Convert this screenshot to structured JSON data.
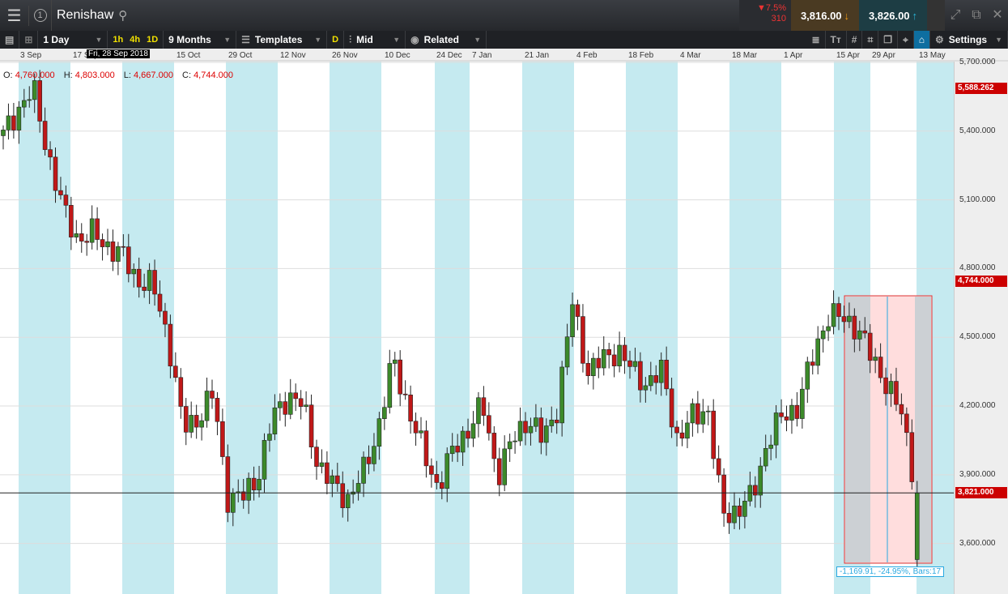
{
  "header": {
    "menu_icon": "hamburger-icon",
    "window_number": "1",
    "title": "Renishaw",
    "search_icon": "search-icon",
    "change_pct": "▼7.5%",
    "change_pts": "310",
    "sell": "3,816.00",
    "buy": "3,826.00",
    "sell_color": "#f39c12",
    "buy_color": "#29b6d8"
  },
  "toolbar": {
    "interval": "1 Day",
    "quick": [
      "1h",
      "4h",
      "1D"
    ],
    "range": "9 Months",
    "templates": "Templates",
    "d": "D",
    "price_type": "Mid",
    "related": "Related",
    "settings": "Settings"
  },
  "tooltip_date": "Fri, 28 Sep 2018",
  "ohlc": {
    "o_label": "O:",
    "o": "4,760.000",
    "h_label": "H:",
    "h": "4,803.000",
    "l_label": "L:",
    "l": "4,667.000",
    "c_label": "C:",
    "c": "4,744.000"
  },
  "measure": "-1,169.91, -24.95%, Bars:17",
  "chart_data": {
    "type": "candlestick",
    "instrument": "Renishaw",
    "interval": "1 Day",
    "x_ticks": [
      "3 Sep",
      "17 Sep",
      "15 Oct",
      "29 Oct",
      "12 Nov",
      "26 Nov",
      "10 Dec",
      "24 Dec",
      "7 Jan",
      "21 Jan",
      "4 Feb",
      "18 Feb",
      "4 Mar",
      "18 Mar",
      "1 Apr",
      "15 Apr",
      "29 Apr",
      "13 May"
    ],
    "y_ticks": [
      "5,700.000",
      "5,400.000",
      "5,100.000",
      "4,800.000",
      "4,500.000",
      "4,200.000",
      "3,900.000",
      "3,600.000"
    ],
    "ylim": [
      3440,
      5720
    ],
    "price_tags": [
      "5,588.262",
      "4,744.000",
      "3,821.000"
    ],
    "close_path": [
      5380,
      5500,
      5580,
      5300,
      5050,
      4930,
      4950,
      4900,
      4850,
      4750,
      4720,
      4500,
      4100,
      4150,
      4250,
      3800,
      3800,
      3900,
      4150,
      4250,
      4200,
      3950,
      3850,
      3800,
      3900,
      4100,
      4400,
      4200,
      4000,
      3850,
      4000,
      4100,
      4200,
      3900,
      4050,
      4150,
      4050,
      4200,
      4650,
      4350,
      4400,
      4450,
      4350,
      4300,
      4350,
      4050,
      4150,
      4200,
      3720,
      3750,
      3800,
      4050,
      4150,
      4200,
      4400,
      4600,
      4580,
      4550,
      4400,
      4300,
      4150,
      3821
    ]
  }
}
